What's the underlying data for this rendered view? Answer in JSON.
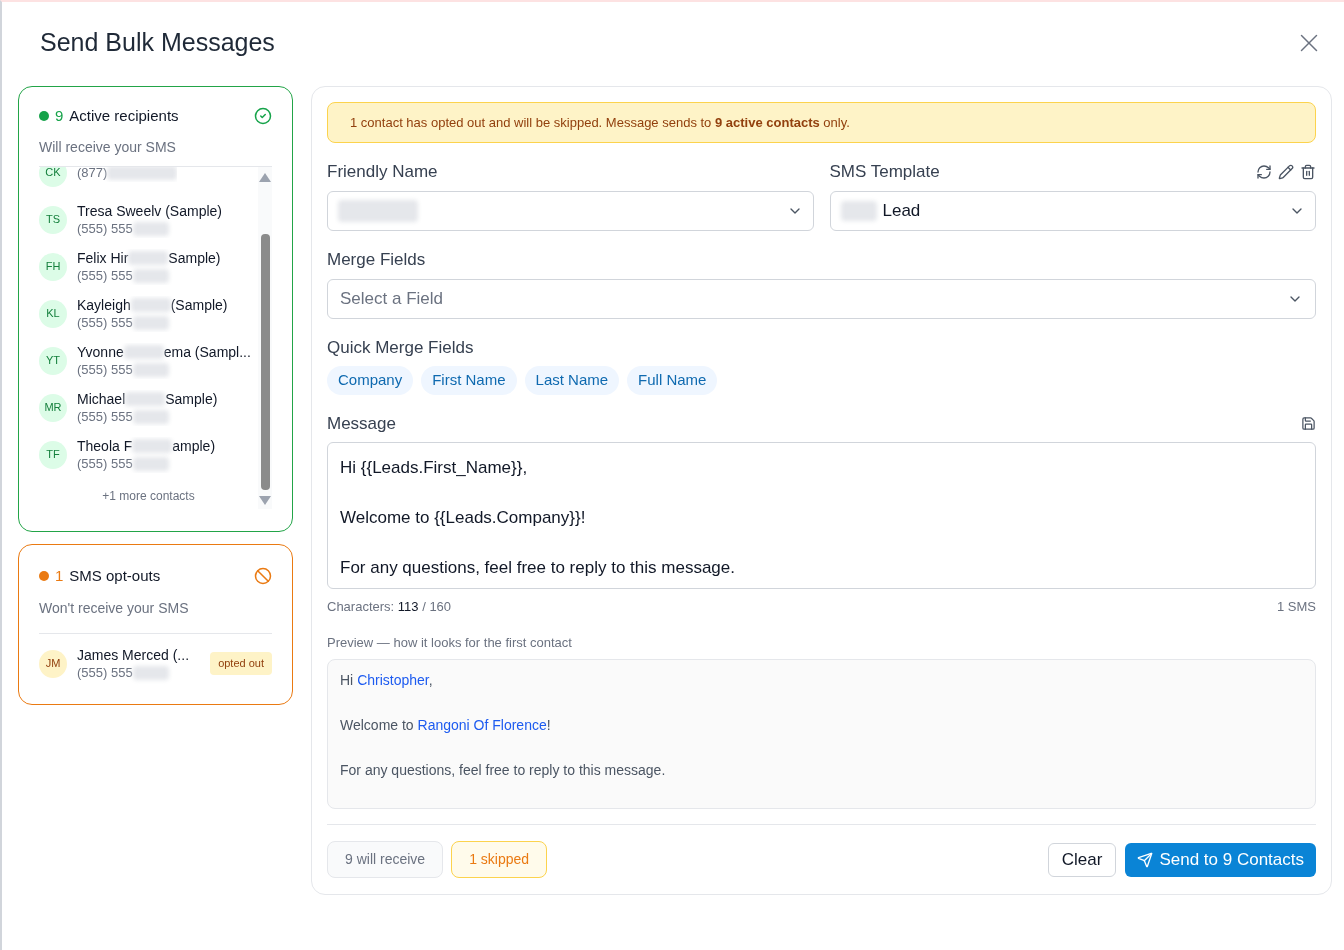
{
  "title": "Send Bulk Messages",
  "active": {
    "count": "9",
    "label": "Active recipients",
    "subtitle": "Will receive your SMS",
    "more": "+1 more contacts",
    "contacts": [
      {
        "initials": "CK",
        "phone": "(877)"
      },
      {
        "initials": "TS",
        "name_parts": [
          "Tresa Sweelv (Sample)"
        ],
        "phone": "(555) 555"
      },
      {
        "initials": "FH",
        "name_parts": [
          "Felix Hir",
          "Sample)"
        ],
        "phone": "(555) 555"
      },
      {
        "initials": "KL",
        "name_parts": [
          "Kayleigh",
          "(Sample)"
        ],
        "phone": "(555) 555"
      },
      {
        "initials": "YT",
        "name_parts": [
          "Yvonne",
          "ema (Sampl..."
        ],
        "phone": "(555) 555"
      },
      {
        "initials": "MR",
        "name_parts": [
          "Michael",
          "Sample)"
        ],
        "phone": "(555) 555"
      },
      {
        "initials": "TF",
        "name_parts": [
          "Theola F",
          "ample)"
        ],
        "phone": "(555) 555"
      }
    ]
  },
  "optouts": {
    "count": "1",
    "label": "SMS opt-outs",
    "subtitle": "Won't receive your SMS",
    "contacts": [
      {
        "initials": "JM",
        "name": "James Merced (...",
        "phone": "(555) 555",
        "badge": "opted out"
      }
    ]
  },
  "notice": "1 contact has opted out and will be skipped. Message sends to **9 active contacts** only.",
  "friendly_name": {
    "label": "Friendly Name"
  },
  "sms_template": {
    "label": "SMS Template",
    "value": "Lead"
  },
  "merge_fields": {
    "label": "Merge Fields",
    "placeholder": "Select a Field"
  },
  "quick_merge": {
    "label": "Quick Merge Fields",
    "chips": [
      "Company",
      "First Name",
      "Last Name",
      "Full Name"
    ]
  },
  "message": {
    "label": "Message",
    "paragraphs": [
      "Hi {{Leads.First_Name}},",
      "Welcome to {{Leads.Company}}!",
      "For any questions, feel free to reply to this message."
    ]
  },
  "characters": {
    "label": "Characters: ",
    "count": "113",
    "limit": " / 160",
    "sms": "1 SMS"
  },
  "preview": {
    "label": "Preview — how it looks for the first contact",
    "lines": [
      [
        {
          "kind": "plain",
          "text": "Hi "
        },
        {
          "kind": "merge",
          "text": "Christopher"
        },
        {
          "kind": "plain",
          "text": ","
        }
      ],
      [
        {
          "kind": "plain",
          "text": "Welcome to "
        },
        {
          "kind": "merge",
          "text": "Rangoni Of Florence"
        },
        {
          "kind": "plain",
          "text": "!"
        }
      ],
      [
        {
          "kind": "plain",
          "text": "For any questions, feel free to reply to this message."
        }
      ]
    ]
  },
  "footer": {
    "receive": "9 will receive",
    "skipped": "1 skipped",
    "clear": "Clear",
    "send": "Send to 9 Contacts"
  }
}
